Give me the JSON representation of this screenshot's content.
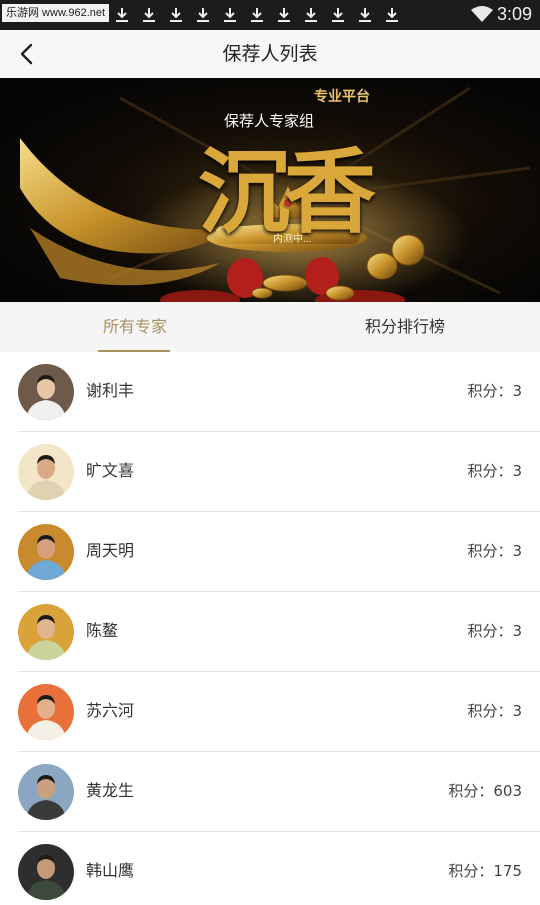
{
  "status_bar": {
    "watermark": "乐游网 www.962.net",
    "time": "3:09",
    "download_icon_count": 11
  },
  "nav": {
    "title": "保荐人列表"
  },
  "banner": {
    "platform": "专业平台",
    "group": "保荐人专家组",
    "big_text": "沉香",
    "sub": "内测中..."
  },
  "tabs": [
    {
      "label": "所有专家",
      "active": true
    },
    {
      "label": "积分排行榜",
      "active": false
    }
  ],
  "accent_color": "#a9925f",
  "experts": [
    {
      "name": "谢利丰",
      "score": "积分：3"
    },
    {
      "name": "旷文喜",
      "score": "积分：3"
    },
    {
      "name": "周天明",
      "score": "积分：3"
    },
    {
      "name": "陈鳌",
      "score": "积分：3"
    },
    {
      "name": "苏六河",
      "score": "积分：3"
    },
    {
      "name": "黄龙生",
      "score": "积分：603"
    },
    {
      "name": "韩山鹰",
      "score": "积分：175"
    }
  ]
}
